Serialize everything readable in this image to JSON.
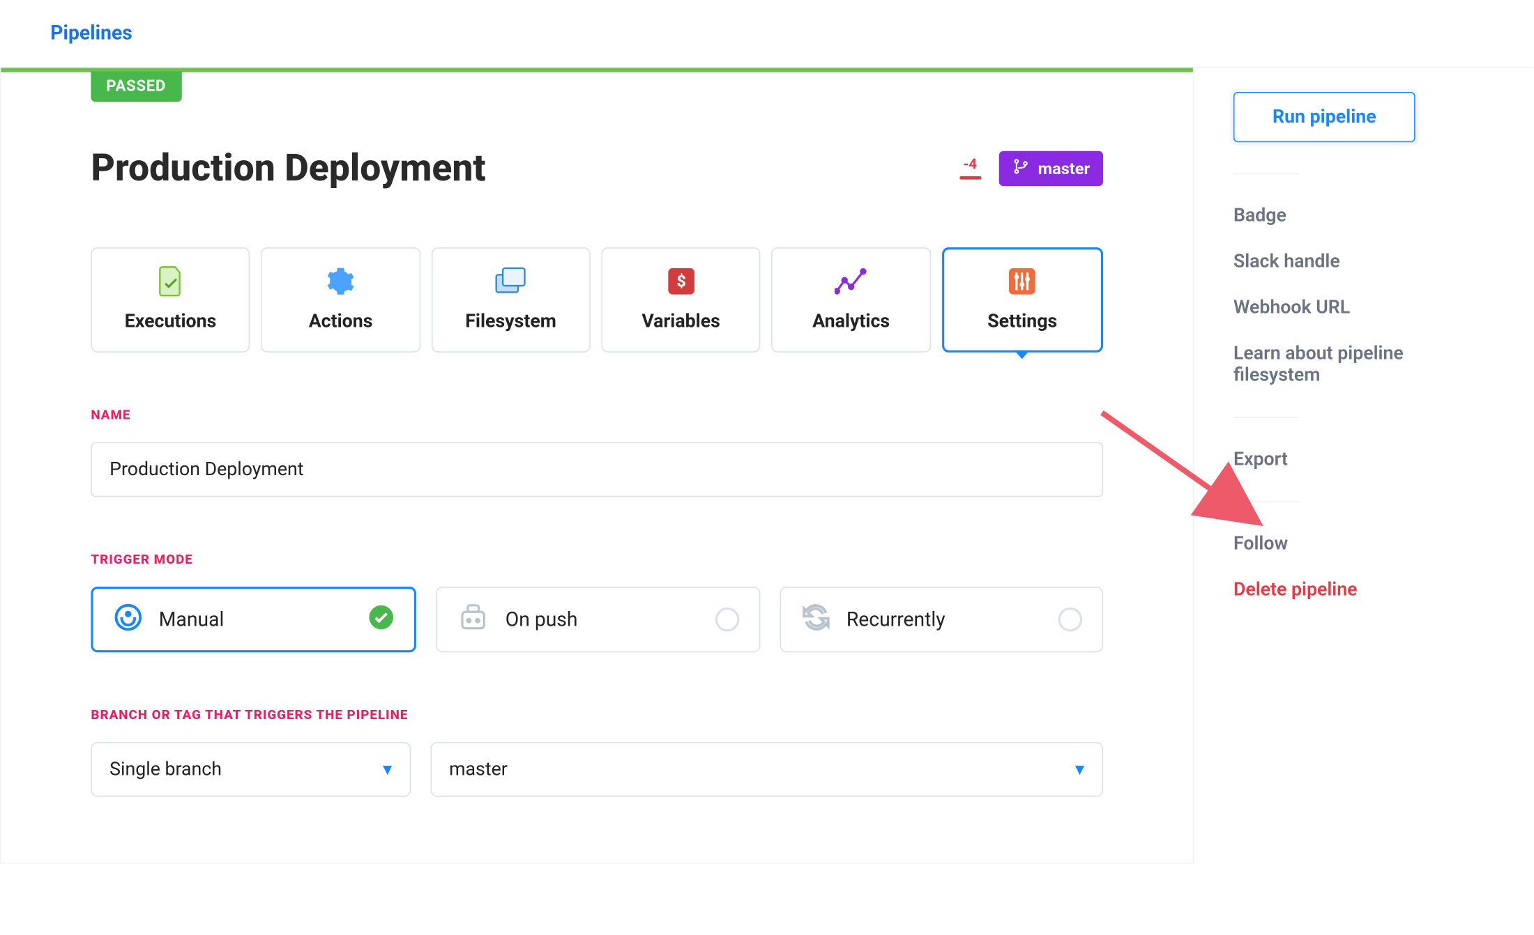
{
  "topbar": {
    "pipelines_link": "Pipelines"
  },
  "status_badge": "PASSED",
  "page_title": "Production Deployment",
  "commits_behind": "-4",
  "branch_label": "master",
  "tabs": {
    "executions": "Executions",
    "actions": "Actions",
    "filesystem": "Filesystem",
    "variables": "Variables",
    "analytics": "Analytics",
    "settings": "Settings"
  },
  "sections": {
    "name_label": "NAME",
    "name_value": "Production Deployment",
    "trigger_label": "TRIGGER MODE",
    "branch_label": "BRANCH OR TAG THAT TRIGGERS THE PIPELINE"
  },
  "trigger_modes": {
    "manual": "Manual",
    "on_push": "On push",
    "recurrently": "Recurrently"
  },
  "branch_selects": {
    "scope": "Single branch",
    "branch": "master"
  },
  "sidebar": {
    "run_pipeline": "Run pipeline",
    "badge": "Badge",
    "slack": "Slack handle",
    "webhook": "Webhook URL",
    "learn_fs": "Learn about pipeline filesystem",
    "export": "Export",
    "follow": "Follow",
    "delete": "Delete pipeline"
  },
  "colors": {
    "blue": "#1b87ff",
    "green": "#6cc24a",
    "pink": "#e91e63",
    "danger": "#e53946",
    "purple": "#8a2be2"
  }
}
